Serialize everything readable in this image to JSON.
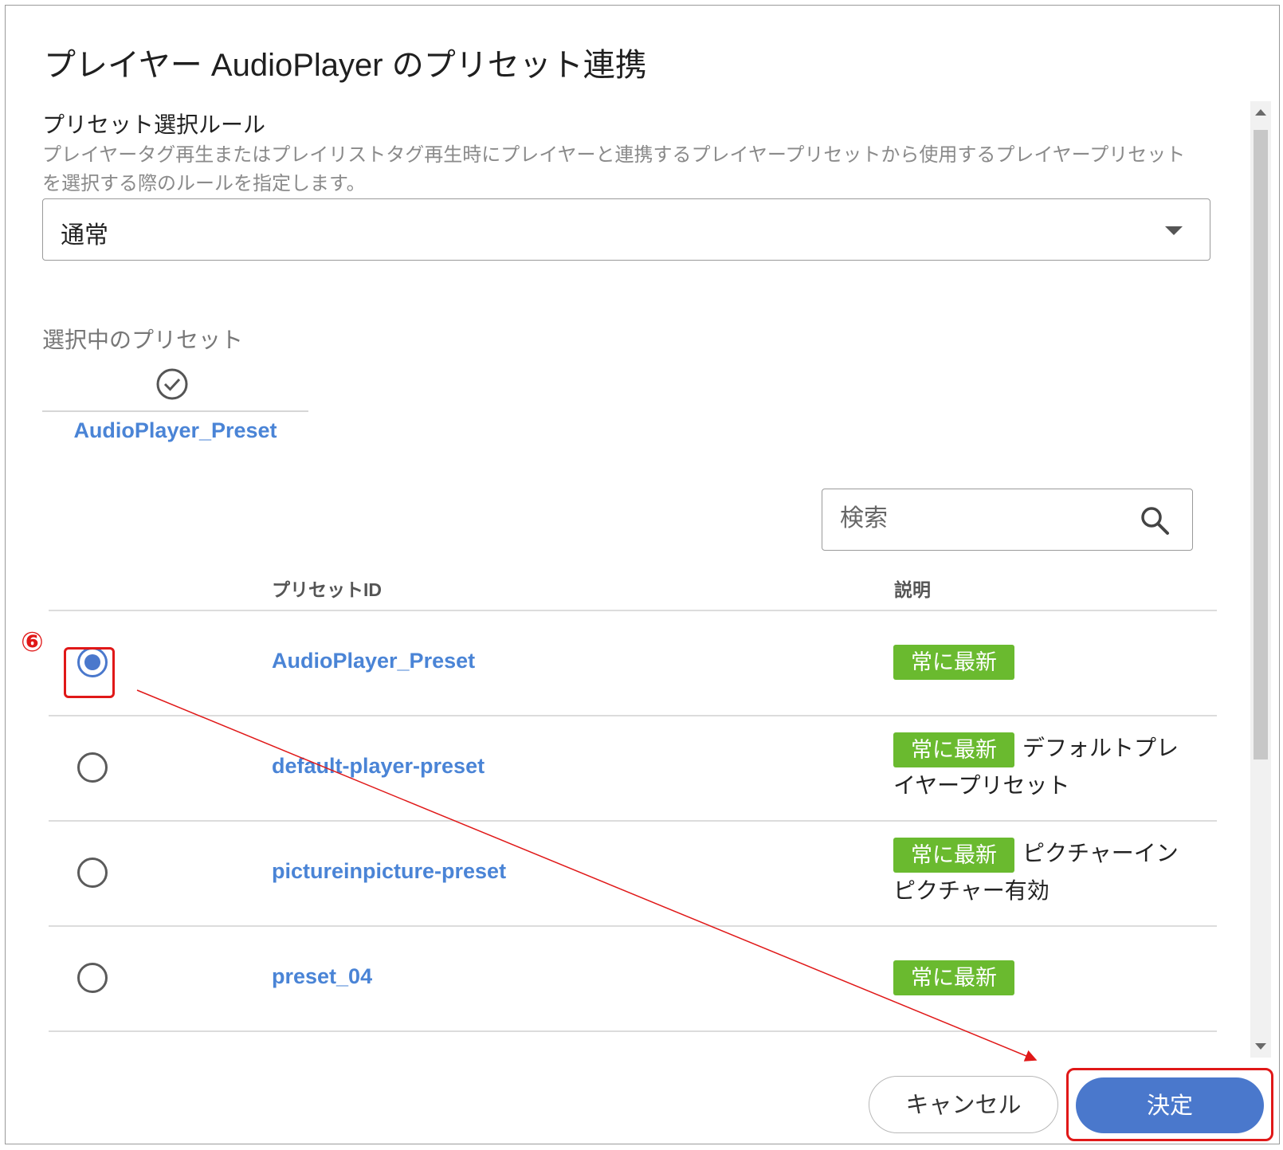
{
  "dialog": {
    "title": "プレイヤー AudioPlayer のプリセット連携"
  },
  "rule": {
    "label": "プリセット選択ルール",
    "description": "プレイヤータグ再生またはプレイリストタグ再生時にプレイヤーと連携するプレイヤープリセットから使用するプレイヤープリセットを選択する際のルールを指定します。",
    "selected_value": "通常"
  },
  "selected_preset": {
    "label": "選択中のプリセット",
    "icon": "check-circle-icon",
    "name": "AudioPlayer_Preset"
  },
  "search": {
    "placeholder": "検索",
    "value": ""
  },
  "table": {
    "columns": [
      "プリセットID",
      "説明"
    ],
    "rows": [
      {
        "id": "AudioPlayer_Preset",
        "badge": "常に最新",
        "description": "",
        "checked": true
      },
      {
        "id": "default-player-preset",
        "badge": "常に最新",
        "description": "デフォルトプレイヤープリセット",
        "checked": false
      },
      {
        "id": "pictureinpicture-preset",
        "badge": "常に最新",
        "description": "ピクチャーインピクチャー有効",
        "checked": false
      },
      {
        "id": "preset_04",
        "badge": "常に最新",
        "description": "",
        "checked": false
      }
    ]
  },
  "footer": {
    "cancel_label": "キャンセル",
    "ok_label": "決定"
  },
  "annotation": {
    "step_label": "⑥"
  },
  "colors": {
    "accent": "#4a78cc",
    "link": "#4a84d6",
    "badge": "#6aba2f",
    "annotation": "#e01818"
  }
}
